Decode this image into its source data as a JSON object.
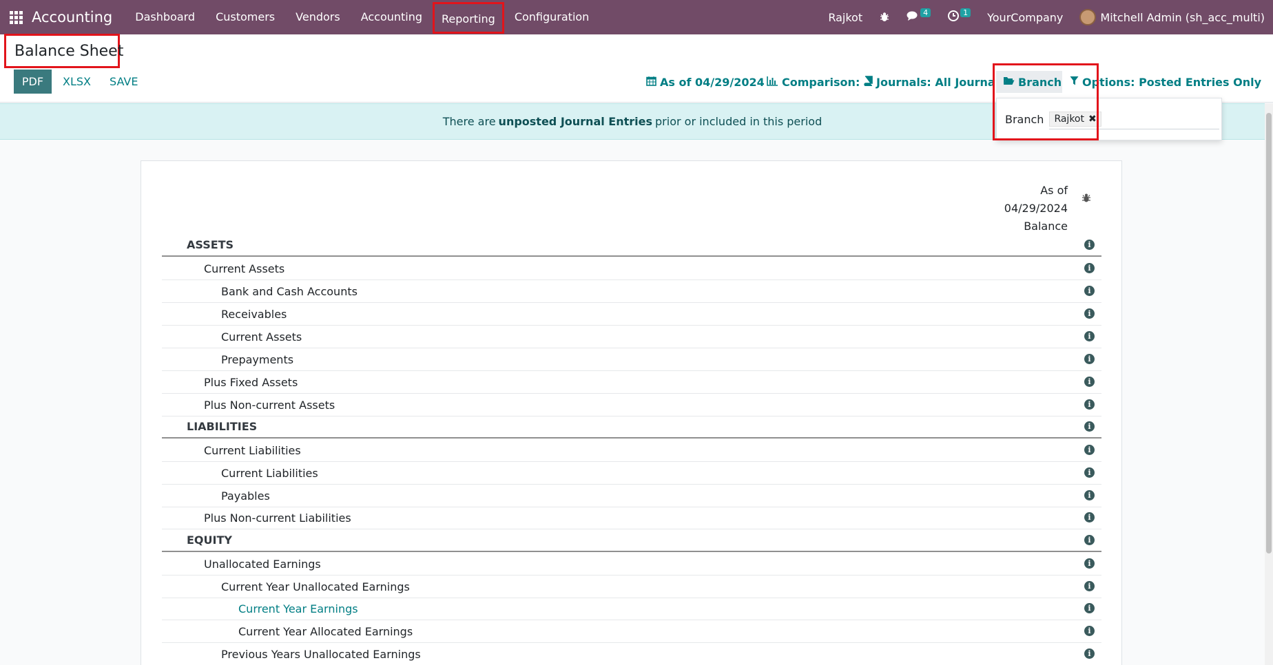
{
  "navbar": {
    "app_name": "Accounting",
    "menu": [
      {
        "label": "Dashboard"
      },
      {
        "label": "Customers"
      },
      {
        "label": "Vendors"
      },
      {
        "label": "Accounting"
      },
      {
        "label": "Reporting"
      },
      {
        "label": "Configuration"
      }
    ],
    "branch": "Rajkot",
    "messages_count": "4",
    "activities_count": "1",
    "company": "YourCompany",
    "user": "Mitchell Admin (sh_acc_multi)"
  },
  "page": {
    "title": "Balance Sheet",
    "buttons": {
      "pdf": "PDF",
      "xlsx": "XLSX",
      "save": "SAVE"
    }
  },
  "filters": {
    "date": "As of 04/29/2024",
    "comparison": "Comparison:",
    "journals": "Journals: All Journals",
    "branch": "Branch",
    "options": "Options: Posted Entries Only"
  },
  "branch_dropdown": {
    "label": "Branch",
    "tag": "Rajkot"
  },
  "alert": {
    "before": "There are",
    "bold": "unposted Journal Entries",
    "after": "prior or included in this period"
  },
  "report": {
    "column_header": [
      "As of",
      "04/29/2024",
      "Balance"
    ],
    "lines": [
      {
        "label": "ASSETS",
        "level": 0
      },
      {
        "label": "Current Assets",
        "level": 1
      },
      {
        "label": "Bank and Cash Accounts",
        "level": 2
      },
      {
        "label": "Receivables",
        "level": 2
      },
      {
        "label": "Current Assets",
        "level": 2
      },
      {
        "label": "Prepayments",
        "level": 2
      },
      {
        "label": "Plus Fixed Assets",
        "level": 1
      },
      {
        "label": "Plus Non-current Assets",
        "level": 1
      },
      {
        "label": "LIABILITIES",
        "level": 0
      },
      {
        "label": "Current Liabilities",
        "level": 1
      },
      {
        "label": "Current Liabilities",
        "level": 2
      },
      {
        "label": "Payables",
        "level": 2
      },
      {
        "label": "Plus Non-current Liabilities",
        "level": 1
      },
      {
        "label": "EQUITY",
        "level": 0
      },
      {
        "label": "Unallocated Earnings",
        "level": 1
      },
      {
        "label": "Current Year Unallocated Earnings",
        "level": 2
      },
      {
        "label": "Current Year Earnings",
        "level": 3,
        "link": true
      },
      {
        "label": "Current Year Allocated Earnings",
        "level": 3
      },
      {
        "label": "Previous Years Unallocated Earnings",
        "level": 2
      }
    ]
  }
}
